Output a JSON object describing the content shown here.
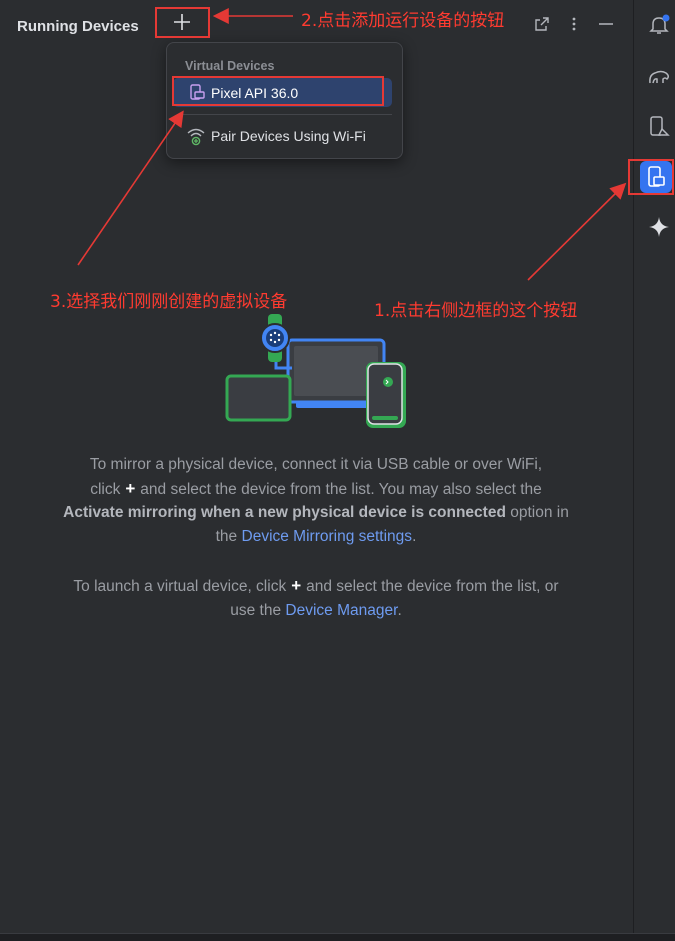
{
  "header": {
    "title": "Running Devices"
  },
  "popup": {
    "section_label": "Virtual Devices",
    "selected_item": "Pixel API 36.0",
    "pair_item": "Pair Devices Using Wi-Fi"
  },
  "annotations": {
    "step1": "1.点击右侧边框的这个按钮",
    "step2": "2.点击添加运行设备的按钮",
    "step3": "3.选择我们刚刚创建的虚拟设备",
    "color": "#e53935"
  },
  "empty_state": {
    "p1_a": "To mirror a physical device, connect it via USB cable or over WiFi, click",
    "p1_b": "and select the device from the list. You may also select the",
    "p1_bold": "Activate mirroring when a new physical device is connected",
    "p1_c": "option in the",
    "p1_link": "Device Mirroring settings",
    "p1_d": ".",
    "p2_a": "To launch a virtual device, click",
    "p2_b": "and select the device from the list, or use the",
    "p2_link": "Device Manager",
    "p2_c": ".",
    "plus_glyph": "+"
  },
  "right_toolbar": {
    "icons": [
      "notifications-icon",
      "gradle-elephant-icon",
      "device-manager-icon",
      "running-devices-icon",
      "gemini-sparkle-icon"
    ],
    "active": "running-devices-icon",
    "accent": "#3574f0"
  }
}
